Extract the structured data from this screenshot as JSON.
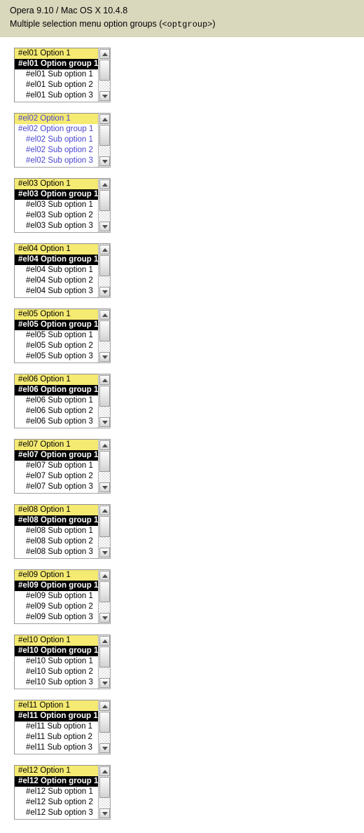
{
  "header": {
    "line1": "Opera 9.10 / Mac OS X 10.4.8",
    "line2_prefix": "Multiple selection menu option groups (",
    "line2_mono": "<optgroup>",
    "line2_suffix": ")",
    "background_color": "#d9d7bc"
  },
  "colors": {
    "page_background": "#ffffff",
    "selected_option_background": "#f5ea72",
    "optgroup_background": "#000000",
    "optgroup_text": "#ffffff",
    "blue_variant_text": "#4a46cf",
    "box_border": "#a2a2a2"
  },
  "selects": [
    {
      "id": "el01",
      "style": "default",
      "options": [
        {
          "label": "#el01 Option 1",
          "kind": "option",
          "selected": true
        },
        {
          "label": "#el01 Option group 1",
          "kind": "optgroup",
          "selected": false
        },
        {
          "label": "#el01 Sub option 1",
          "kind": "suboption",
          "selected": false
        },
        {
          "label": "#el01 Sub option 2",
          "kind": "suboption",
          "selected": false
        },
        {
          "label": "#el01 Sub option 3",
          "kind": "suboption",
          "selected": false
        }
      ]
    },
    {
      "id": "el02",
      "style": "blue",
      "options": [
        {
          "label": "#el02 Option 1",
          "kind": "option",
          "selected": true
        },
        {
          "label": "#el02 Option group 1",
          "kind": "optgroup",
          "selected": false
        },
        {
          "label": "#el02 Sub option 1",
          "kind": "suboption",
          "selected": false
        },
        {
          "label": "#el02 Sub option 2",
          "kind": "suboption",
          "selected": false
        },
        {
          "label": "#el02 Sub option 3",
          "kind": "suboption",
          "selected": false
        }
      ]
    },
    {
      "id": "el03",
      "style": "default",
      "options": [
        {
          "label": "#el03 Option 1",
          "kind": "option",
          "selected": true
        },
        {
          "label": "#el03 Option group 1",
          "kind": "optgroup",
          "selected": false
        },
        {
          "label": "#el03 Sub option 1",
          "kind": "suboption",
          "selected": false
        },
        {
          "label": "#el03 Sub option 2",
          "kind": "suboption",
          "selected": false
        },
        {
          "label": "#el03 Sub option 3",
          "kind": "suboption",
          "selected": false
        }
      ]
    },
    {
      "id": "el04",
      "style": "default",
      "options": [
        {
          "label": "#el04 Option 1",
          "kind": "option",
          "selected": true
        },
        {
          "label": "#el04 Option group 1",
          "kind": "optgroup",
          "selected": false
        },
        {
          "label": "#el04 Sub option 1",
          "kind": "suboption",
          "selected": false
        },
        {
          "label": "#el04 Sub option 2",
          "kind": "suboption",
          "selected": false
        },
        {
          "label": "#el04 Sub option 3",
          "kind": "suboption",
          "selected": false
        }
      ]
    },
    {
      "id": "el05",
      "style": "default",
      "options": [
        {
          "label": "#el05 Option 1",
          "kind": "option",
          "selected": true
        },
        {
          "label": "#el05 Option group 1",
          "kind": "optgroup",
          "selected": false
        },
        {
          "label": "#el05 Sub option 1",
          "kind": "suboption",
          "selected": false
        },
        {
          "label": "#el05 Sub option 2",
          "kind": "suboption",
          "selected": false
        },
        {
          "label": "#el05 Sub option 3",
          "kind": "suboption",
          "selected": false
        }
      ]
    },
    {
      "id": "el06",
      "style": "default",
      "options": [
        {
          "label": "#el06 Option 1",
          "kind": "option",
          "selected": true
        },
        {
          "label": "#el06 Option group 1",
          "kind": "optgroup",
          "selected": false
        },
        {
          "label": "#el06 Sub option 1",
          "kind": "suboption",
          "selected": false
        },
        {
          "label": "#el06 Sub option 2",
          "kind": "suboption",
          "selected": false
        },
        {
          "label": "#el06 Sub option 3",
          "kind": "suboption",
          "selected": false
        }
      ]
    },
    {
      "id": "el07",
      "style": "default",
      "options": [
        {
          "label": "#el07 Option 1",
          "kind": "option",
          "selected": true
        },
        {
          "label": "#el07 Option group 1",
          "kind": "optgroup",
          "selected": false
        },
        {
          "label": "#el07 Sub option 1",
          "kind": "suboption",
          "selected": false
        },
        {
          "label": "#el07 Sub option 2",
          "kind": "suboption",
          "selected": false
        },
        {
          "label": "#el07 Sub option 3",
          "kind": "suboption",
          "selected": false
        }
      ]
    },
    {
      "id": "el08",
      "style": "default",
      "options": [
        {
          "label": "#el08 Option 1",
          "kind": "option",
          "selected": true
        },
        {
          "label": "#el08 Option group 1",
          "kind": "optgroup",
          "selected": false
        },
        {
          "label": "#el08 Sub option 1",
          "kind": "suboption",
          "selected": false
        },
        {
          "label": "#el08 Sub option 2",
          "kind": "suboption",
          "selected": false
        },
        {
          "label": "#el08 Sub option 3",
          "kind": "suboption",
          "selected": false
        }
      ]
    },
    {
      "id": "el09",
      "style": "default",
      "options": [
        {
          "label": "#el09 Option 1",
          "kind": "option",
          "selected": true
        },
        {
          "label": "#el09 Option group 1",
          "kind": "optgroup",
          "selected": false
        },
        {
          "label": "#el09 Sub option 1",
          "kind": "suboption",
          "selected": false
        },
        {
          "label": "#el09 Sub option 2",
          "kind": "suboption",
          "selected": false
        },
        {
          "label": "#el09 Sub option 3",
          "kind": "suboption",
          "selected": false
        }
      ]
    },
    {
      "id": "el10",
      "style": "default",
      "options": [
        {
          "label": "#el10 Option 1",
          "kind": "option",
          "selected": true
        },
        {
          "label": "#el10 Option group 1",
          "kind": "optgroup",
          "selected": false
        },
        {
          "label": "#el10 Sub option 1",
          "kind": "suboption",
          "selected": false
        },
        {
          "label": "#el10 Sub option 2",
          "kind": "suboption",
          "selected": false
        },
        {
          "label": "#el10 Sub option 3",
          "kind": "suboption",
          "selected": false
        }
      ]
    },
    {
      "id": "el11",
      "style": "default",
      "options": [
        {
          "label": "#el11 Option 1",
          "kind": "option",
          "selected": true
        },
        {
          "label": "#el11 Option group 1",
          "kind": "optgroup",
          "selected": false
        },
        {
          "label": "#el11 Sub option 1",
          "kind": "suboption",
          "selected": false
        },
        {
          "label": "#el11 Sub option 2",
          "kind": "suboption",
          "selected": false
        },
        {
          "label": "#el11 Sub option 3",
          "kind": "suboption",
          "selected": false
        }
      ]
    },
    {
      "id": "el12",
      "style": "default",
      "options": [
        {
          "label": "#el12 Option 1",
          "kind": "option",
          "selected": true
        },
        {
          "label": "#el12 Option group 1",
          "kind": "optgroup",
          "selected": false
        },
        {
          "label": "#el12 Sub option 1",
          "kind": "suboption",
          "selected": false
        },
        {
          "label": "#el12 Sub option 2",
          "kind": "suboption",
          "selected": false
        },
        {
          "label": "#el12 Sub option 3",
          "kind": "suboption",
          "selected": false
        }
      ]
    }
  ],
  "scrollbar": {
    "up_icon": "scroll-up-arrow-icon",
    "down_icon": "scroll-down-arrow-icon"
  }
}
